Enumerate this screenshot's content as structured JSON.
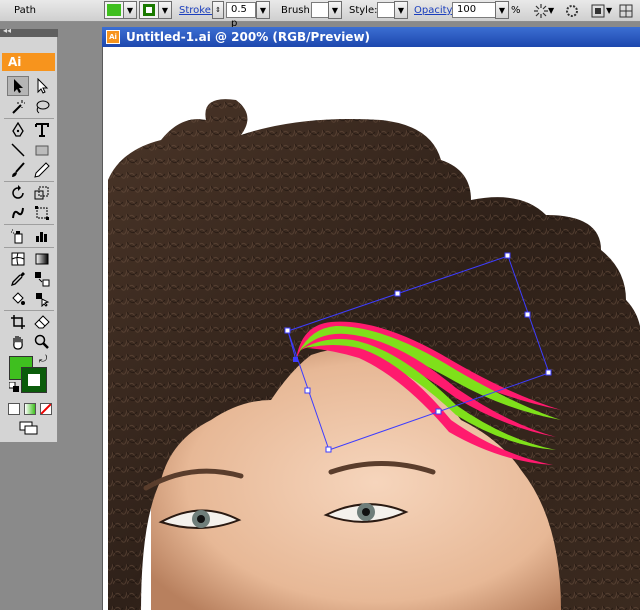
{
  "control_bar": {
    "selection_label": "Path",
    "fill_color": "#3fbf1f",
    "stroke_swatch_color": "#1a7a00",
    "stroke_label": "Stroke:",
    "stroke_weight": "0.5 p",
    "brush_label": "Brush:",
    "style_label": "Style:",
    "opacity_label": "Opacity:",
    "opacity_value": "100",
    "opacity_unit": "%"
  },
  "toolbox": {
    "panel_toggle": "◂◂",
    "logo": "Ai",
    "fill_color": "#3fbf1f",
    "stroke_color": "#0a5c0a"
  },
  "document": {
    "title": "Untitled-1.ai @ 200% (RGB/Preview)",
    "icon_label": "Ai"
  },
  "colors": {
    "selection_bbox": "#3d3dff",
    "stroke_pink": "#ff1a6e",
    "stroke_green": "#7fe01a",
    "hair": "#3a2a20",
    "skin": "#f2cdb1"
  }
}
